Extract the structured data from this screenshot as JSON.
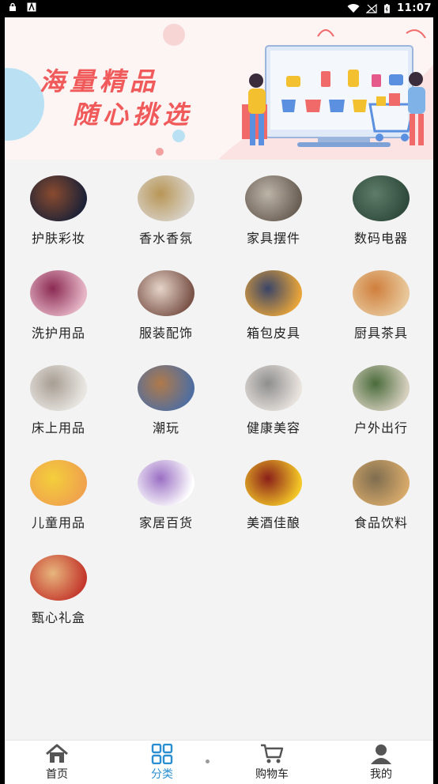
{
  "statusbar": {
    "time": "11:07"
  },
  "banner": {
    "line1": "海量精品",
    "line2": "随心挑选"
  },
  "categories": [
    {
      "label": "护肤彩妆",
      "icon": "skincare-icon",
      "colors": [
        "#1d2236",
        "#8a4b2f"
      ]
    },
    {
      "label": "香水香氛",
      "icon": "perfume-icon",
      "colors": [
        "#d8d2c8",
        "#b89656"
      ]
    },
    {
      "label": "家具摆件",
      "icon": "furniture-icon",
      "colors": [
        "#6a5f55",
        "#bdb4a8"
      ]
    },
    {
      "label": "数码电器",
      "icon": "digital-icon",
      "colors": [
        "#2f4a3c",
        "#5e7c69"
      ]
    },
    {
      "label": "洗护用品",
      "icon": "washcare-icon",
      "colors": [
        "#e6b6c6",
        "#8b2a53"
      ]
    },
    {
      "label": "服装配饰",
      "icon": "apparel-icon",
      "colors": [
        "#7a5348",
        "#e6d4c9"
      ]
    },
    {
      "label": "箱包皮具",
      "icon": "bag-icon",
      "colors": [
        "#e7a43a",
        "#3a4568"
      ]
    },
    {
      "label": "厨具茶具",
      "icon": "kitchen-icon",
      "colors": [
        "#e8c89b",
        "#cf7f3d"
      ]
    },
    {
      "label": "床上用品",
      "icon": "bedding-icon",
      "colors": [
        "#e9e6e2",
        "#a79e93"
      ]
    },
    {
      "label": "潮玩",
      "icon": "toy-icon",
      "colors": [
        "#4f6ea1",
        "#b07a4a"
      ]
    },
    {
      "label": "健康美容",
      "icon": "health-icon",
      "colors": [
        "#e9e3de",
        "#8e8e8e"
      ]
    },
    {
      "label": "户外出行",
      "icon": "outdoor-icon",
      "colors": [
        "#d6d0bf",
        "#4a6b3b"
      ]
    },
    {
      "label": "儿童用品",
      "icon": "kids-icon",
      "colors": [
        "#f0a24d",
        "#f3cf3b"
      ]
    },
    {
      "label": "家居百货",
      "icon": "cleaning-icon",
      "colors": [
        "#ffffff",
        "#9a6fc4"
      ]
    },
    {
      "label": "美酒佳酿",
      "icon": "wine-icon",
      "colors": [
        "#f4c727",
        "#8a1f1a"
      ]
    },
    {
      "label": "食品饮料",
      "icon": "food-icon",
      "colors": [
        "#d7a96a",
        "#7e6d4f"
      ]
    },
    {
      "label": "甄心礼盒",
      "icon": "giftbox-icon",
      "colors": [
        "#c4382d",
        "#e7b67d"
      ]
    }
  ],
  "tabs": [
    {
      "label": "首页",
      "icon": "home-icon"
    },
    {
      "label": "分类",
      "icon": "category-icon"
    },
    {
      "label": "购物车",
      "icon": "cart-icon"
    },
    {
      "label": "我的",
      "icon": "profile-icon"
    }
  ]
}
